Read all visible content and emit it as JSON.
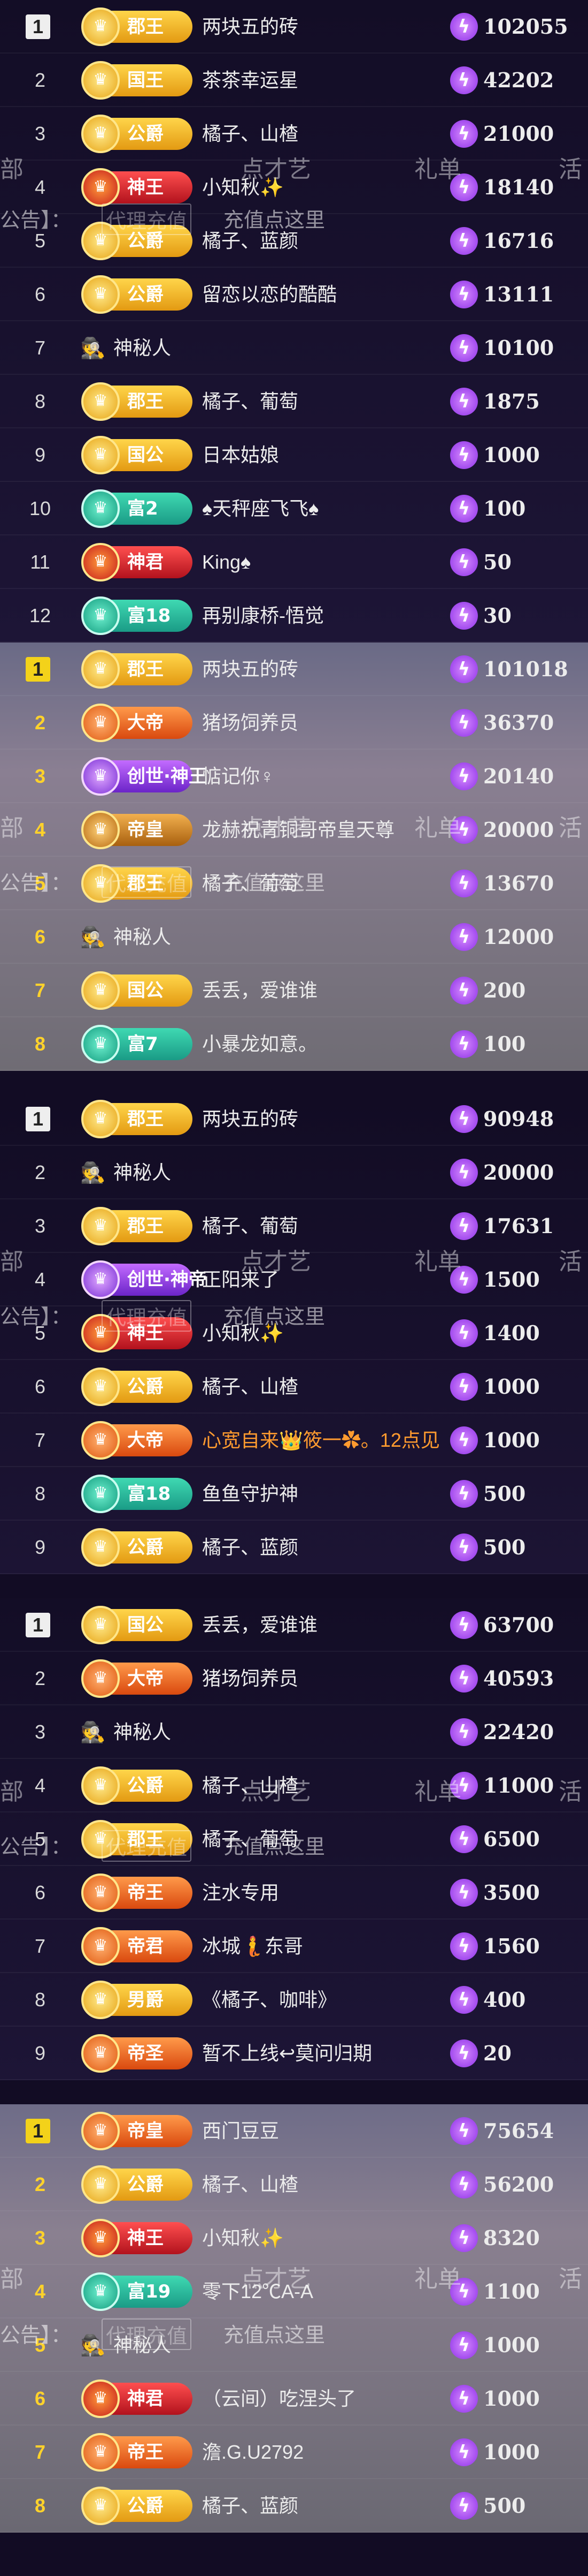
{
  "panels": [
    {
      "rows": [
        {
          "rank": "1",
          "rank_style": "r1",
          "badge": "郡王",
          "badge_style": "b-gold",
          "name": "两块五的砖",
          "value": "102055"
        },
        {
          "rank": "2",
          "badge": "国王",
          "badge_style": "b-gold",
          "name": "茶茶幸运星",
          "value": "42202"
        },
        {
          "rank": "3",
          "badge": "公爵",
          "badge_style": "b-gold",
          "name": "橘子、山楂",
          "value": "21000"
        },
        {
          "rank": "4",
          "badge": "神王",
          "badge_style": "b-red",
          "name": "小知秋✨",
          "value": "18140"
        },
        {
          "rank": "5",
          "badge": "公爵",
          "badge_style": "b-gold",
          "name": "橘子、蓝颜",
          "value": "16716"
        },
        {
          "rank": "6",
          "badge": "公爵",
          "badge_style": "b-gold",
          "name": "留恋以恋的酷酷",
          "value": "13111"
        },
        {
          "rank": "7",
          "avatar": "mystery",
          "name": "神秘人",
          "value": "10100"
        },
        {
          "rank": "8",
          "badge": "郡王",
          "badge_style": "b-gold",
          "name": "橘子、葡萄",
          "value": "1875"
        },
        {
          "rank": "9",
          "badge": "国公",
          "badge_style": "b-gold",
          "name": "日本姑娘",
          "value": "1000"
        },
        {
          "rank": "10",
          "badge": "富2",
          "badge_style": "b-teal",
          "name": "♠天秤座飞飞♠",
          "value": "100"
        },
        {
          "rank": "11",
          "badge": "神君",
          "badge_style": "b-red",
          "name": "King♠",
          "value": "50"
        },
        {
          "rank": "12",
          "badge": "富18",
          "badge_style": "b-teal",
          "name": "再别康桥-悟觉",
          "value": "30"
        }
      ]
    },
    {
      "rows": [
        {
          "rank": "1",
          "rank_style": "ry",
          "badge": "郡王",
          "badge_style": "b-gold",
          "name": "两块五的砖",
          "value": "101018"
        },
        {
          "rank": "2",
          "rank_style": "gold",
          "badge": "大帝",
          "badge_style": "b-orange",
          "name": "猪场饲养员",
          "value": "36370"
        },
        {
          "rank": "3",
          "rank_style": "gold",
          "badge": "创世·神王",
          "badge_style": "b-purple",
          "name": "惦记你♀",
          "value": "20140"
        },
        {
          "rank": "4",
          "rank_style": "gold",
          "badge": "帝皇",
          "badge_style": "b-brown",
          "name": "龙赫祝青铜哥帝皇天尊",
          "value": "20000"
        },
        {
          "rank": "5",
          "rank_style": "gold",
          "badge": "郡王",
          "badge_style": "b-gold",
          "name": "橘子、葡萄",
          "value": "13670"
        },
        {
          "rank": "6",
          "rank_style": "gold",
          "avatar": "mystery",
          "name": "神秘人",
          "value": "12000"
        },
        {
          "rank": "7",
          "rank_style": "gold",
          "badge": "国公",
          "badge_style": "b-gold",
          "name": "丢丢，爱谁谁",
          "value": "200"
        },
        {
          "rank": "8",
          "rank_style": "gold",
          "badge": "富7",
          "badge_style": "b-teal",
          "name": "小暴龙如意。",
          "value": "100"
        }
      ]
    },
    {
      "rows": [
        {
          "rank": "1",
          "rank_style": "r1",
          "badge": "郡王",
          "badge_style": "b-gold",
          "name": "两块五的砖",
          "value": "90948"
        },
        {
          "rank": "2",
          "avatar": "mystery",
          "name": "神秘人",
          "value": "20000"
        },
        {
          "rank": "3",
          "badge": "郡王",
          "badge_style": "b-gold",
          "name": "橘子、葡萄",
          "value": "17631"
        },
        {
          "rank": "4",
          "badge": "创世·神帝",
          "badge_style": "b-purple",
          "name": "正阳来了",
          "value": "1500"
        },
        {
          "rank": "5",
          "badge": "神王",
          "badge_style": "b-red",
          "name": "小知秋✨",
          "value": "1400"
        },
        {
          "rank": "6",
          "badge": "公爵",
          "badge_style": "b-gold",
          "name": "橘子、山楂",
          "value": "1000"
        },
        {
          "rank": "7",
          "badge": "大帝",
          "badge_style": "b-orange",
          "name": "心宽自来👑筱一✿。12点见",
          "name_style": "orange",
          "value": "1000"
        },
        {
          "rank": "8",
          "badge": "富18",
          "badge_style": "b-teal",
          "name": "鱼鱼守护神",
          "value": "500"
        },
        {
          "rank": "9",
          "badge": "公爵",
          "badge_style": "b-gold",
          "name": "橘子、蓝颜",
          "value": "500"
        }
      ]
    },
    {
      "rows": [
        {
          "rank": "1",
          "rank_style": "r1",
          "badge": "国公",
          "badge_style": "b-gold",
          "name": "丢丢，爱谁谁",
          "value": "63700"
        },
        {
          "rank": "2",
          "badge": "大帝",
          "badge_style": "b-orange",
          "name": "猪场饲养员",
          "value": "40593"
        },
        {
          "rank": "3",
          "avatar": "mystery",
          "name": "神秘人",
          "value": "22420"
        },
        {
          "rank": "4",
          "badge": "公爵",
          "badge_style": "b-gold",
          "name": "橘子、山楂",
          "value": "11000"
        },
        {
          "rank": "5",
          "badge": "郡王",
          "badge_style": "b-gold",
          "name": "橘子、葡萄",
          "value": "6500"
        },
        {
          "rank": "6",
          "badge": "帝王",
          "badge_style": "b-orange",
          "name": "注水专用",
          "value": "3500"
        },
        {
          "rank": "7",
          "badge": "帝君",
          "badge_style": "b-orange",
          "name": "冰城🧜东哥",
          "value": "1560"
        },
        {
          "rank": "8",
          "badge": "男爵",
          "badge_style": "b-gold",
          "name": "《橘子、咖啡》",
          "value": "400"
        },
        {
          "rank": "9",
          "badge": "帝圣",
          "badge_style": "b-orange",
          "name": "暂不上线↩莫问归期",
          "value": "20"
        }
      ]
    },
    {
      "rows": [
        {
          "rank": "1",
          "rank_style": "ry",
          "badge": "帝皇",
          "badge_style": "b-orange",
          "name": "西门豆豆",
          "value": "75654"
        },
        {
          "rank": "2",
          "rank_style": "gold",
          "badge": "公爵",
          "badge_style": "b-gold",
          "name": "橘子、山楂",
          "value": "56200"
        },
        {
          "rank": "3",
          "rank_style": "gold",
          "badge": "神王",
          "badge_style": "b-red",
          "name": "小知秋✨",
          "value": "8320"
        },
        {
          "rank": "4",
          "rank_style": "gold",
          "badge": "富19",
          "badge_style": "b-teal",
          "name": "零下12℃A-A",
          "value": "1100"
        },
        {
          "rank": "5",
          "rank_style": "gold",
          "avatar": "mystery",
          "name": "神秘人",
          "value": "1000"
        },
        {
          "rank": "6",
          "rank_style": "gold",
          "badge": "神君",
          "badge_style": "b-red",
          "name": "（云间）吃涅头了",
          "value": "1000"
        },
        {
          "rank": "7",
          "rank_style": "gold",
          "badge": "帝王",
          "badge_style": "b-orange",
          "name": "澹.G.U2792",
          "value": "1000"
        },
        {
          "rank": "8",
          "rank_style": "gold",
          "badge": "公爵",
          "badge_style": "b-gold",
          "name": "橘子、蓝颜",
          "value": "500"
        }
      ]
    }
  ],
  "overlays": {
    "tabs": [
      "部",
      "点才艺",
      "礼单",
      "活"
    ],
    "announcement": "公告】：",
    "recharge_button": "代理充值",
    "recharge_text": "充值点这里"
  },
  "coin_icon": "lightning-coin-icon",
  "mystery_icon": "mystery-person-icon",
  "colors": {
    "background": "#120c24",
    "rank_gold": "#ffd22b",
    "accent_purple": "#a64dff"
  }
}
